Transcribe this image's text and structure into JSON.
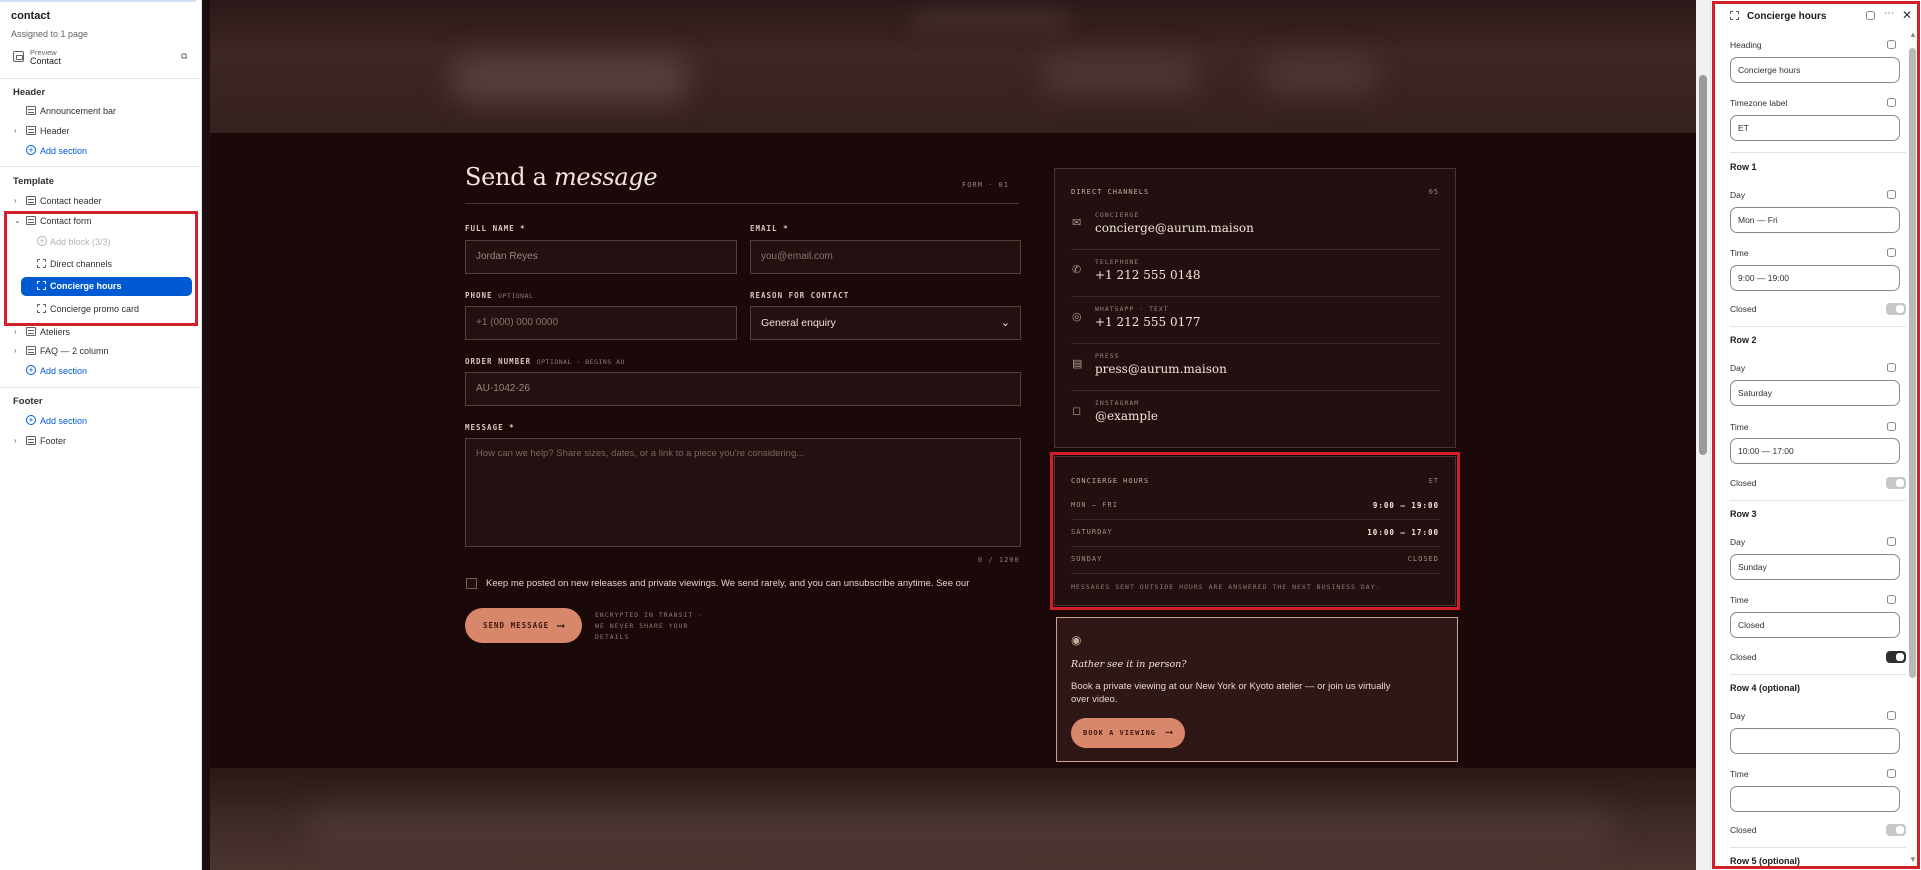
{
  "sidebar": {
    "title": "contact",
    "assigned": "Assigned to 1 page",
    "preview_label": "Preview",
    "preview_value": "Contact",
    "groups": {
      "header": "Header",
      "template": "Template",
      "footer": "Footer"
    },
    "header_items": [
      "Announcement bar",
      "Header"
    ],
    "template_items": [
      "Contact header",
      "Contact form"
    ],
    "contact_form_blocks": {
      "add_block": "Add block (3/3)",
      "direct_channels": "Direct channels",
      "concierge_hours": "Concierge hours",
      "promo_card": "Concierge promo card"
    },
    "template_items_after": [
      "Ateliers",
      "FAQ — 2 column"
    ],
    "footer_items": [
      "Footer"
    ],
    "add_section": "Add section"
  },
  "form": {
    "title_plain": "Send a",
    "title_italic": "message",
    "code": "FORM · 01",
    "full_name_label": "FULL NAME *",
    "full_name_value": "Jordan Reyes",
    "email_label": "EMAIL *",
    "email_placeholder": "you@email.com",
    "phone_label": "PHONE",
    "phone_optional": "OPTIONAL",
    "phone_placeholder": "+1 (000) 000 0000",
    "reason_label": "REASON FOR CONTACT",
    "reason_value": "General enquiry",
    "order_label": "ORDER NUMBER",
    "order_optional": "OPTIONAL · BEGINS AU",
    "order_value": "AU-1042-26",
    "message_label": "MESSAGE *",
    "message_placeholder": "How can we help? Share sizes, dates, or a link to a piece you're considering...",
    "char_count": "0 / 1200",
    "newsletter": "Keep me posted on new releases and private viewings. We send rarely, and you can unsubscribe anytime. See our",
    "send_label": "SEND MESSAGE",
    "secure_note": "ENCRYPTED IN TRANSIT · WE NEVER SHARE YOUR DETAILS"
  },
  "channels": {
    "heading": "DIRECT CHANNELS",
    "number": "05",
    "items": [
      {
        "label": "CONCIERGE",
        "value": "concierge@aurum.maison",
        "icon": "mail-icon"
      },
      {
        "label": "TELEPHONE",
        "value": "+1 212 555 0148",
        "icon": "phone-icon"
      },
      {
        "label": "WHATSAPP · TEXT",
        "value": "+1 212 555 0177",
        "icon": "whatsapp-icon"
      },
      {
        "label": "PRESS",
        "value": "press@aurum.maison",
        "icon": "press-icon"
      },
      {
        "label": "INSTAGRAM",
        "value": "@example",
        "icon": "instagram-icon"
      }
    ]
  },
  "hours": {
    "heading": "CONCIERGE HOURS",
    "timezone": "ET",
    "rows": [
      {
        "day": "MON — FRI",
        "time": "9:00 — 19:00"
      },
      {
        "day": "SATURDAY",
        "time": "10:00 — 17:00"
      },
      {
        "day": "SUNDAY",
        "time": "CLOSED"
      }
    ],
    "note": "MESSAGES SENT OUTSIDE HOURS ARE ANSWERED THE NEXT BUSINESS DAY."
  },
  "promo": {
    "heading_plain": "Rather see it",
    "heading_italic": "in person?",
    "body": "Book a private viewing at our New York or Kyoto atelier — or join us virtually over video.",
    "button": "BOOK A VIEWING"
  },
  "panel": {
    "title": "Concierge hours",
    "heading_label": "Heading",
    "heading_value": "Concierge hours",
    "timezone_label": "Timezone label",
    "timezone_value": "ET",
    "day_label": "Day",
    "time_label": "Time",
    "closed_label": "Closed",
    "rows": [
      {
        "title": "Row 1",
        "day": "Mon — Fri",
        "time": "9:00 — 19:00",
        "closed": false
      },
      {
        "title": "Row 2",
        "day": "Saturday",
        "time": "10:00 — 17:00",
        "closed": false
      },
      {
        "title": "Row 3",
        "day": "Sunday",
        "time": "Closed",
        "closed": true
      },
      {
        "title": "Row 4 (optional)",
        "day": "",
        "time": "",
        "closed": false
      }
    ],
    "row5_title": "Row 5 (optional)"
  },
  "colors": {
    "accent": "#005bd3",
    "highlight": "#d0202a",
    "button": "#d9876a",
    "canvas_bg": "#1b0808"
  }
}
